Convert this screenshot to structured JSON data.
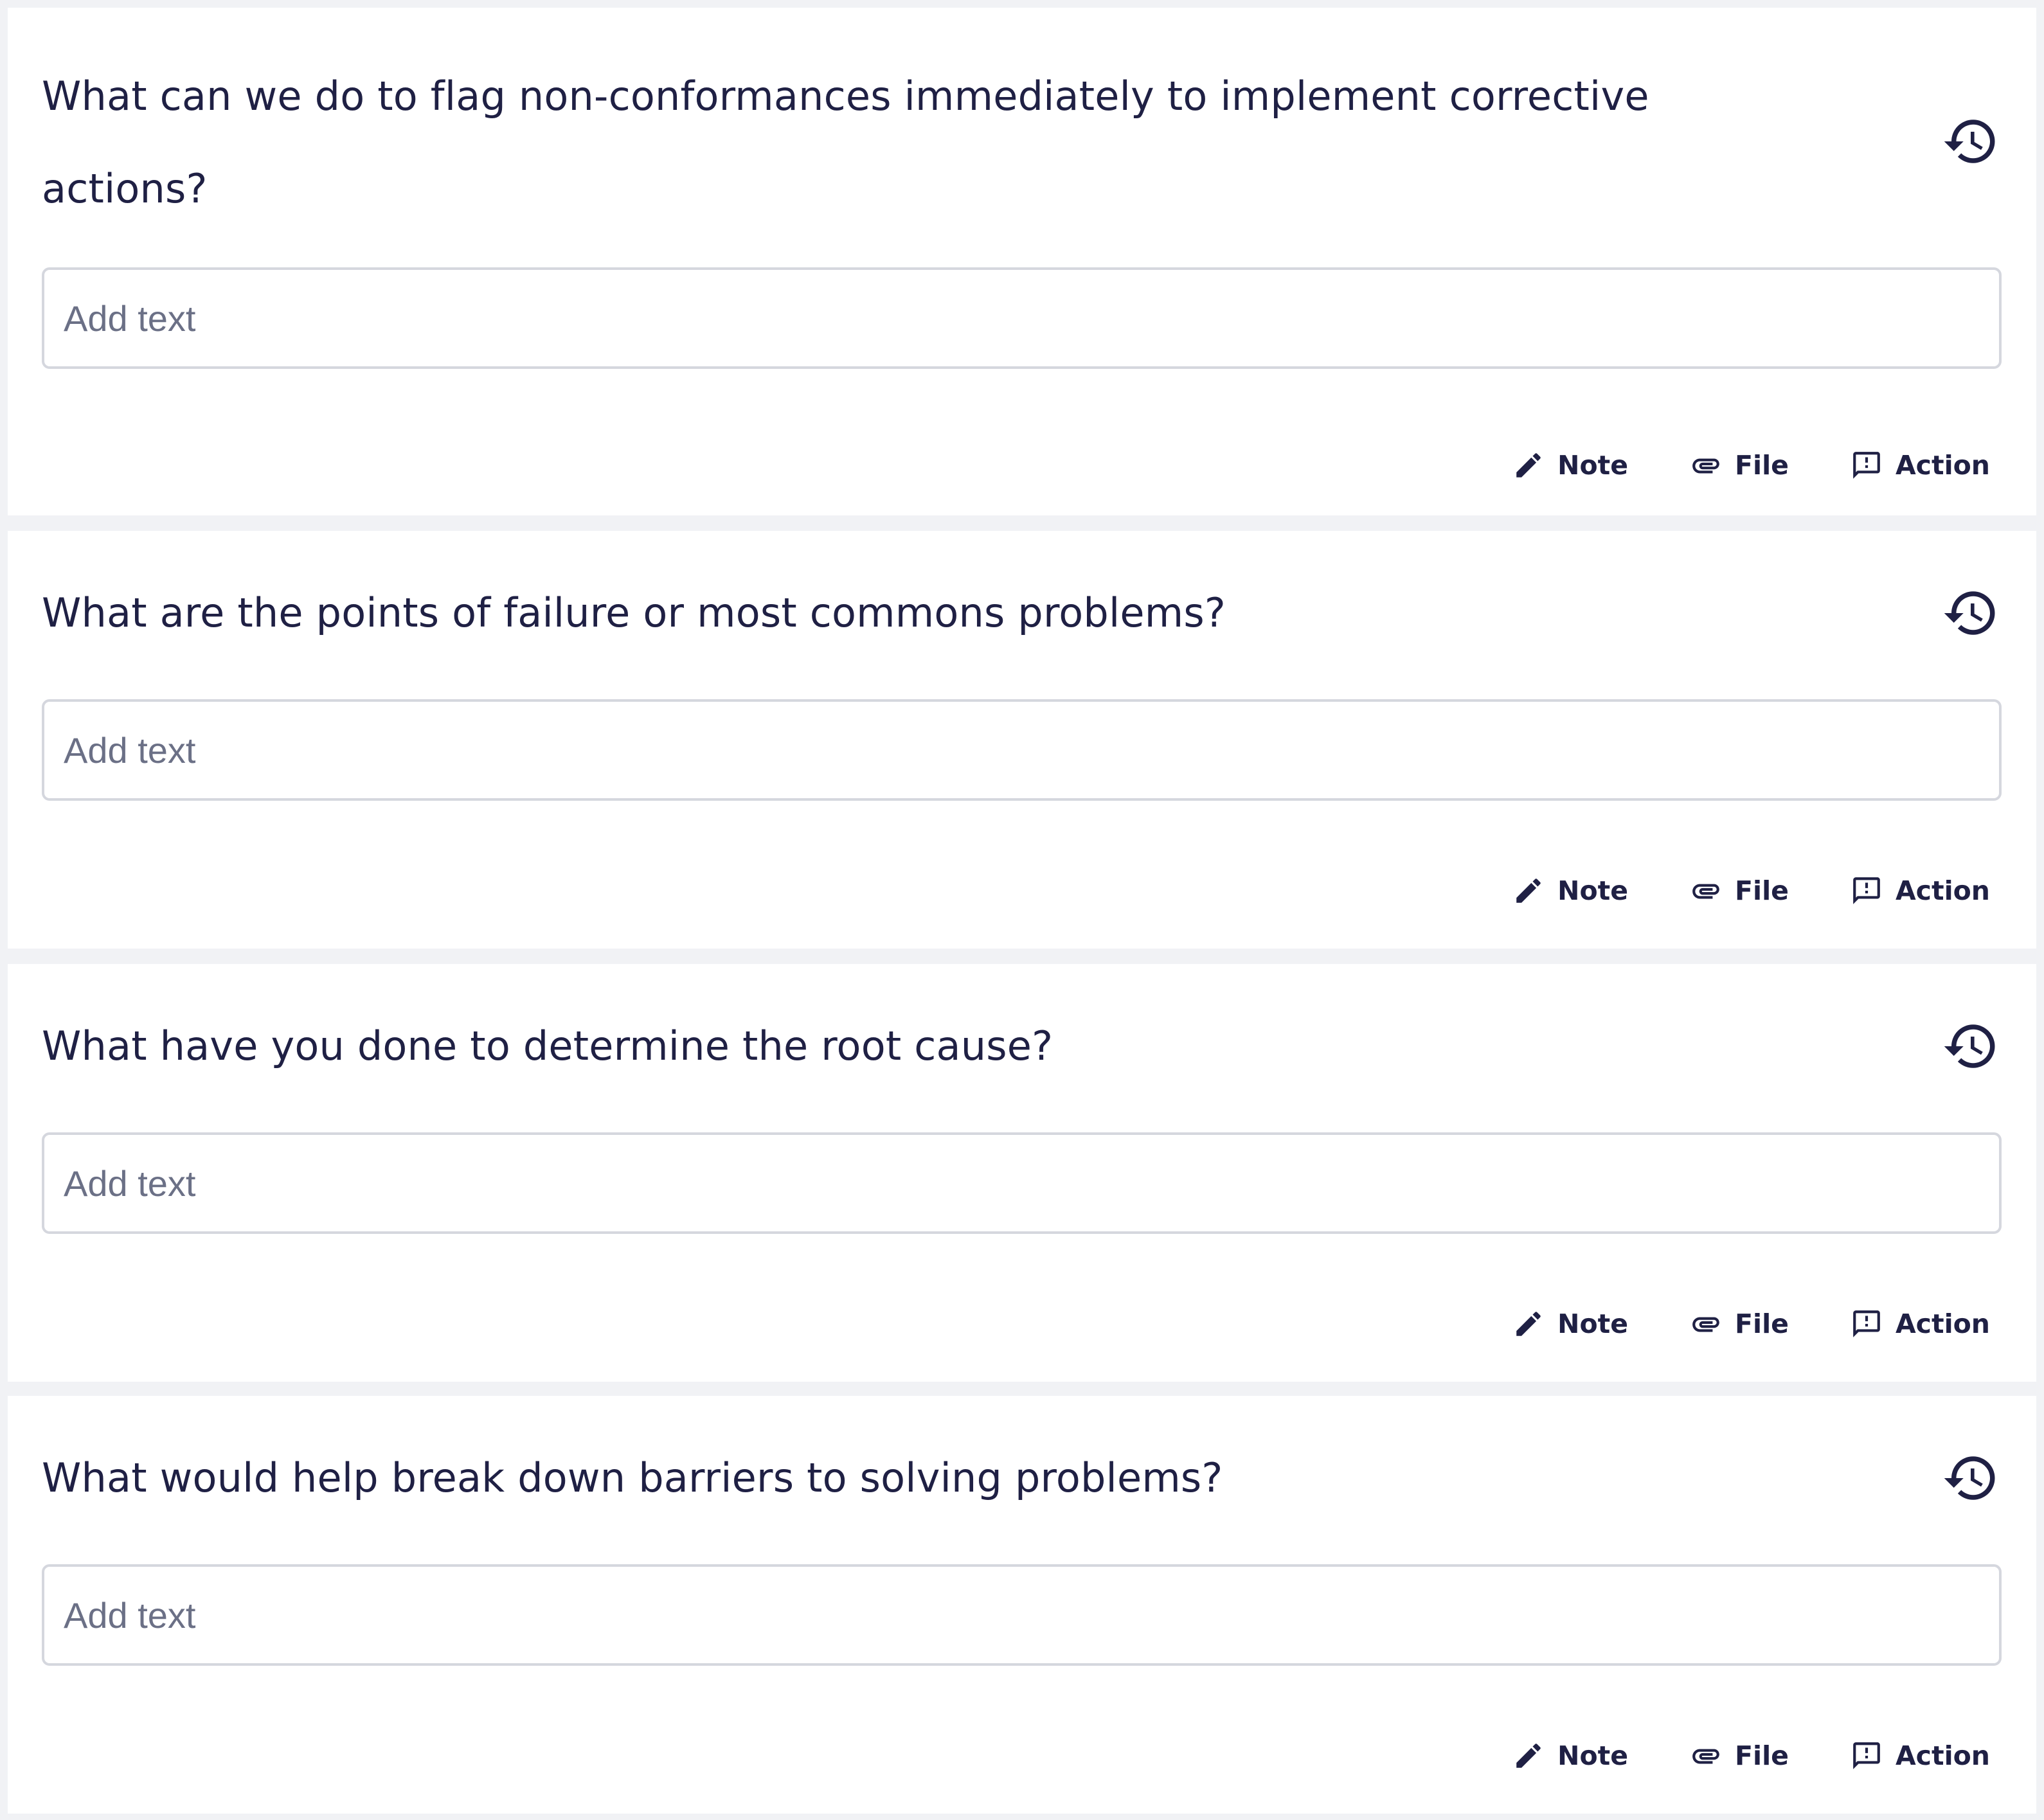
{
  "colors": {
    "background": "#f1f2f5",
    "card": "#ffffff",
    "text": "#1f2044",
    "placeholder": "#6b7086",
    "input_border": "#d5d7de"
  },
  "icons": {
    "history": "history-icon",
    "note": "pencil-icon",
    "file": "paperclip-icon",
    "action": "action-icon"
  },
  "questions": [
    {
      "text": "What can we do to flag non-conformances immediately to implement corrective actions?",
      "input": {
        "value": "",
        "placeholder": "Add text"
      },
      "buttons": {
        "note": "Note",
        "file": "File",
        "action": "Action"
      }
    },
    {
      "text": "What are the points of failure or most commons problems?",
      "input": {
        "value": "",
        "placeholder": "Add text"
      },
      "buttons": {
        "note": "Note",
        "file": "File",
        "action": "Action"
      }
    },
    {
      "text": "What have you done to determine the root cause?",
      "input": {
        "value": "",
        "placeholder": "Add text"
      },
      "buttons": {
        "note": "Note",
        "file": "File",
        "action": "Action"
      }
    },
    {
      "text": "What would help break down barriers to solving problems?",
      "input": {
        "value": "",
        "placeholder": "Add text"
      },
      "buttons": {
        "note": "Note",
        "file": "File",
        "action": "Action"
      }
    }
  ]
}
